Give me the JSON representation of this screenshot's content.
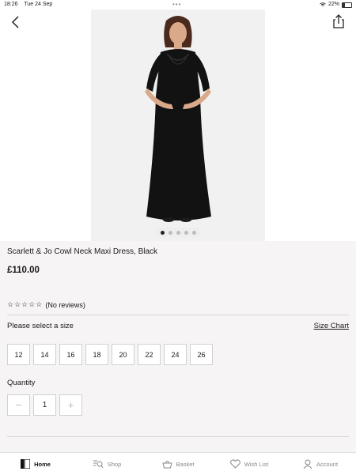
{
  "status": {
    "time": "18:26",
    "date": "Tue 24 Sep",
    "battery": "22%",
    "dots": "•••"
  },
  "product": {
    "title": "Scarlett & Jo Cowl Neck Maxi Dress, Black",
    "price": "£110.00",
    "stars": "☆☆☆☆☆",
    "reviews": "(No reviews)",
    "image_count": 5,
    "active_image": 1
  },
  "size": {
    "label": "Please select a size",
    "chart_link": "Size Chart",
    "options": [
      "12",
      "14",
      "16",
      "18",
      "20",
      "22",
      "24",
      "26"
    ]
  },
  "quantity": {
    "label": "Quantity",
    "value": "1",
    "minus": "−",
    "plus": "+"
  },
  "tabs": [
    {
      "label": "Home",
      "icon": "home-icon",
      "active": true
    },
    {
      "label": "Shop",
      "icon": "shop-search-icon",
      "active": false
    },
    {
      "label": "Basket",
      "icon": "basket-icon",
      "active": false
    },
    {
      "label": "Wish List",
      "icon": "heart-icon",
      "active": false
    },
    {
      "label": "Account",
      "icon": "account-icon",
      "active": false
    }
  ]
}
